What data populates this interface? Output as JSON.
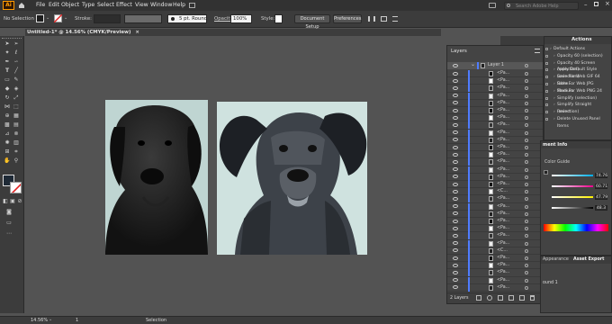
{
  "app": {
    "logo": "Ai",
    "accent": "#ff9a00"
  },
  "menu": [
    "File",
    "Edit",
    "Object",
    "Type",
    "Select",
    "Effect",
    "View",
    "Window",
    "Help"
  ],
  "search": {
    "placeholder": "Search Adobe Help"
  },
  "control": {
    "selection": "No Selection",
    "stroke_label": "Stroke:",
    "brush": "5 pt. Round",
    "opacity_label": "Opacity:",
    "opacity": "100%",
    "style_label": "Style:",
    "doc_setup": "Document Setup",
    "preferences": "Preferences"
  },
  "document": {
    "tab": "Untitled-1* @ 14.56% (CMYK/Preview)"
  },
  "layers": {
    "title": "Layers",
    "layer_name": "Layer 1",
    "item_label": "<Pa...",
    "item_label_c": "<C...",
    "count": "2 Layers"
  },
  "actions": {
    "title": "Actions",
    "items": [
      "Default Actions",
      "Opacity 60 (selection)",
      "Opacity 40 Screen (selection)",
      "Apply Default Style (selection)",
      "Save For Web GIF 64 Dithe...",
      "Save For Web JPG Medium",
      "Save For Web PNG 24",
      "Simplify (selection)",
      "Simplify Straight (selection)",
      "Revert",
      "Delete Unused Panel Items"
    ]
  },
  "docinfo": {
    "title": "ment Info",
    "guide": "Color Guide",
    "values": [
      "74.76",
      "60.71",
      "47.79",
      "48.3"
    ]
  },
  "appearance": {
    "tab1": "Appearance",
    "tab2": "Asset Export",
    "row": "ound 1"
  },
  "status": {
    "zoom": "14.56%",
    "page": "1",
    "tool": "Selection"
  }
}
